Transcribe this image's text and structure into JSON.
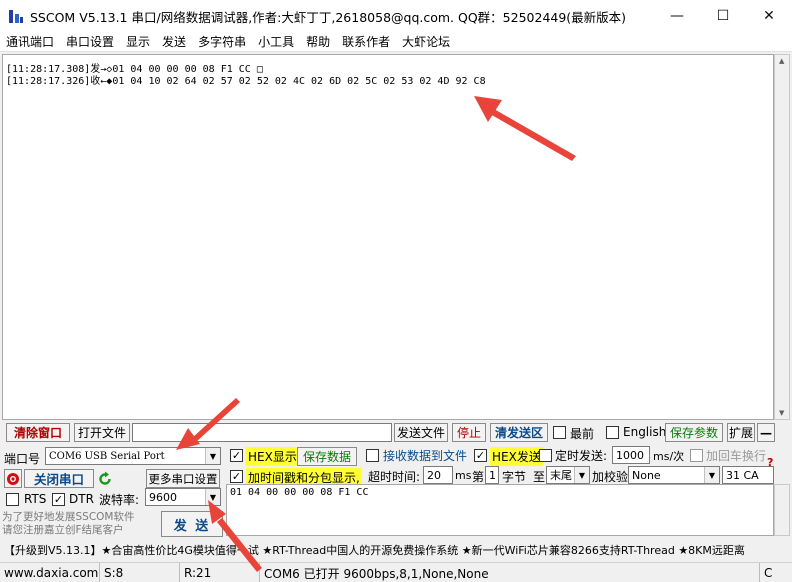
{
  "window": {
    "title": "SSCOM V5.13.1 串口/网络数据调试器,作者:大虾丁丁,2618058@qq.com. QQ群：52502449(最新版本)",
    "minimize": "—",
    "maximize": "☐",
    "close": "✕"
  },
  "menu": [
    "通讯端口",
    "串口设置",
    "显示",
    "发送",
    "多字符串",
    "小工具",
    "帮助",
    "联系作者",
    "大虾论坛"
  ],
  "receive": {
    "lines": [
      "[11:28:17.308]发→◇01 04 00 00 00 08 F1 CC □",
      "[11:28:17.326]收←◆01 04 10 02 64 02 57 02 52 02 4C 02 6D 02 5C 02 53 02 4D 92 C8"
    ]
  },
  "toolbar": {
    "clear_window": "清除窗口",
    "open_file": "打开文件",
    "send_file": "发送文件",
    "stop": "停止",
    "clear_send": "清发送区",
    "topmost": "最前",
    "english": "English",
    "save_params": "保存参数",
    "expand": "扩展",
    "collapse": "—"
  },
  "port": {
    "port_label": "端口号",
    "port_value": "COM6 USB Serial Port",
    "close_port": "关闭串口",
    "more_settings": "更多串口设置",
    "rts": "RTS",
    "dtr": "DTR",
    "baud_label": "波特率:",
    "baud_value": "9600",
    "promo": "为了更好地发展SSCOM软件\n请您注册嘉立创F结尾客户",
    "send_button": "发 送"
  },
  "options": {
    "hex_display": "HEX显示",
    "save_data": "保存数据",
    "recv_to_file": "接收数据到文件",
    "hex_send": "HEX发送",
    "timed_send": "定时发送:",
    "interval": "1000",
    "interval_unit": "ms/次",
    "add_crlf": "加回车换行",
    "timestamp": "加时间戳和分包显示,",
    "timeout_label": "超时时间:",
    "timeout_value": "20",
    "timeout_unit": "ms",
    "byte_prefix": "第",
    "byte_value": "1",
    "byte_suffix": "字节",
    "to_label": "至",
    "to_value": "末尾",
    "checksum_label": "加校验",
    "checksum_value": "None",
    "checksum_result": "31 CA",
    "help": "?"
  },
  "send": {
    "text": "01 04 00 00 00 08 F1 CC"
  },
  "ticker": "【升级到V5.13.1】★合宙高性价比4G模块值得一试 ★RT-Thread中国人的开源免费操作系统 ★新一代WiFi芯片兼容8266支持RT-Thread ★8KM远距离",
  "status": {
    "site": "www.daxia.com",
    "sent": "S:8",
    "recv": "R:21",
    "port_status": "COM6 已打开  9600bps,8,1,None,None",
    "tail": "C"
  },
  "colors": {
    "arrow": "#e8443a",
    "highlight": "#ffff33",
    "green_text": "#0a7a0a",
    "red_text": "#b00000"
  }
}
